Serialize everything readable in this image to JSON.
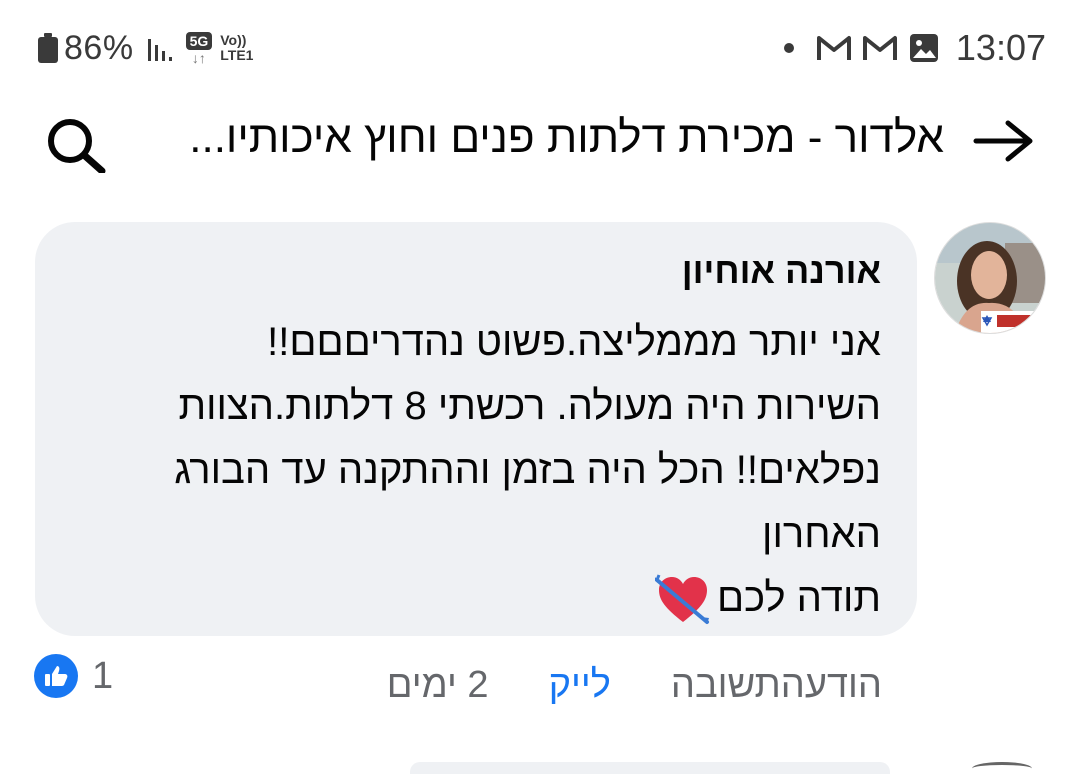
{
  "status_bar": {
    "battery": "86%",
    "network": "5G",
    "volte_top": "Vo))",
    "volte_bottom": "LTE1",
    "time": "13:07",
    "icons": [
      "battery-icon",
      "signal-icon",
      "5g-icon",
      "volte-icon",
      "dot-icon",
      "gmail-icon",
      "gmail-icon",
      "gallery-icon"
    ]
  },
  "header": {
    "title": "אלדור - מכירת דלתות פנים וחוץ איכותיו...",
    "back_icon": "arrow-right-icon",
    "search_icon": "search-icon"
  },
  "comment": {
    "author": "אורנה אוחיון",
    "lines": [
      "אני יותר מממליצה.פשוט נהדריםםם!!",
      "השירות היה מעולה. רכשתי 8 דלתות.הצוות",
      "נפלאים!! הכל היה בזמן וההתקנה עד הבורג",
      "האחרון",
      "תודה לכם"
    ],
    "emoji": "heart-with-arrow-icon"
  },
  "actions": {
    "time": "2 ימים",
    "like": "לייק",
    "reply": "תשובה",
    "message": "הודעה",
    "like_count": "1"
  },
  "colors": {
    "accent": "#1877f2",
    "bubble": "#eff1f4",
    "secondary_text": "#65676b"
  }
}
